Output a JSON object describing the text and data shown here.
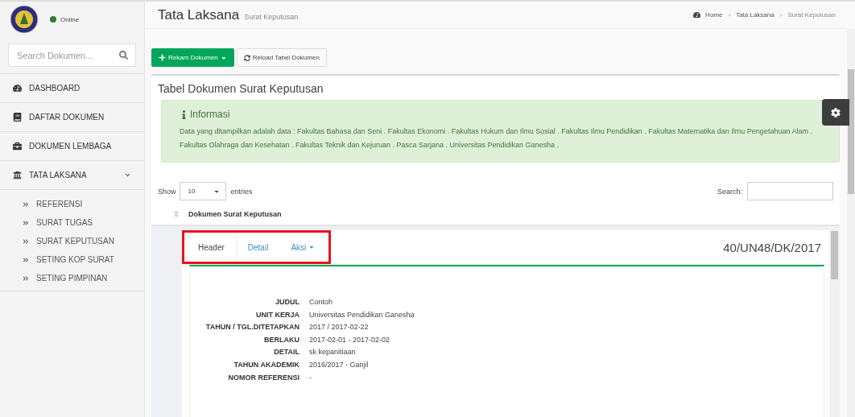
{
  "sidebar": {
    "status": {
      "label": "Online",
      "online": true
    },
    "search": {
      "placeholder": "Search Dokumen..."
    },
    "items": [
      {
        "label": "DASHBOARD"
      },
      {
        "label": "DAFTAR DOKUMEN"
      },
      {
        "label": "DOKUMEN LEMBAGA"
      },
      {
        "label": "TATA LAKSANA",
        "expanded": true,
        "children": [
          {
            "label": "REFERENSI"
          },
          {
            "label": "SURAT TUGAS"
          },
          {
            "label": "SURAT KEPUTUSAN"
          },
          {
            "label": "SETING KOP SURAT"
          },
          {
            "label": "SETING PIMPINAN"
          }
        ]
      }
    ]
  },
  "header": {
    "title": "Tata Laksana",
    "subtitle": "Surat Keputusan",
    "breadcrumb": [
      {
        "label": "Home"
      },
      {
        "separator": ">",
        "label": "Tata Laksana"
      },
      {
        "separator": ">",
        "label": "Surat Keputusan"
      }
    ]
  },
  "toolbar": [
    {
      "label": "Rekam Dokumen",
      "kind": "primary"
    },
    {
      "label": "Reload Tabel Dokumen",
      "kind": "default"
    }
  ],
  "box": {
    "title": "Tabel Dokumen Surat Keputusan",
    "info": {
      "title": "Informasi",
      "text": "Data yang ditampilkan adalah data : Fakultas Bahasa dan Seni  . Fakultas Ekonomi  . Fakultas Hukum dan Ilmu Sosial  . Fakultas Ilmu Pendidikan  . Fakultas Matematika dan Ilmu Pengetahuan Alam  . Fakultas Olahraga dan Kesehatan  . Fakultas Teknik dan Kejuruan  . Pasca Sarjana  . Universitas Pendidikan Ganesha  ."
    },
    "length": {
      "before": "Show",
      "value": "10",
      "after": "entries"
    },
    "search_label": "Search:",
    "column": "Dokumen Surat Keputusan",
    "record": {
      "tabs": [
        {
          "label": "Header",
          "selected": true,
          "kind": "tab"
        },
        {
          "label": "Detail",
          "selected": false,
          "kind": "tab"
        },
        {
          "label": "Aksi",
          "selected": false,
          "kind": "dropdown"
        }
      ],
      "highlighted": true,
      "number": "40/UN48/DK/2017",
      "fields": [
        {
          "label": "JUDUL",
          "value": "Contoh"
        },
        {
          "label": "UNIT KERJA",
          "value": "Universitas Pendidikan Ganesha"
        },
        {
          "label": "TAHUN / TGL.DITETAPKAN",
          "value": "2017 / 2017-02-22"
        },
        {
          "label": "BERLAKU",
          "value": "2017-02-01 - 2017-02-02"
        },
        {
          "label": "DETAIL",
          "value": "sk kepanitiaan"
        },
        {
          "label": "TAHUN AKADEMIK",
          "value": "2016/2017  -  Ganjil"
        },
        {
          "label": "NOMOR REFERENSI",
          "value": "-"
        }
      ]
    }
  }
}
